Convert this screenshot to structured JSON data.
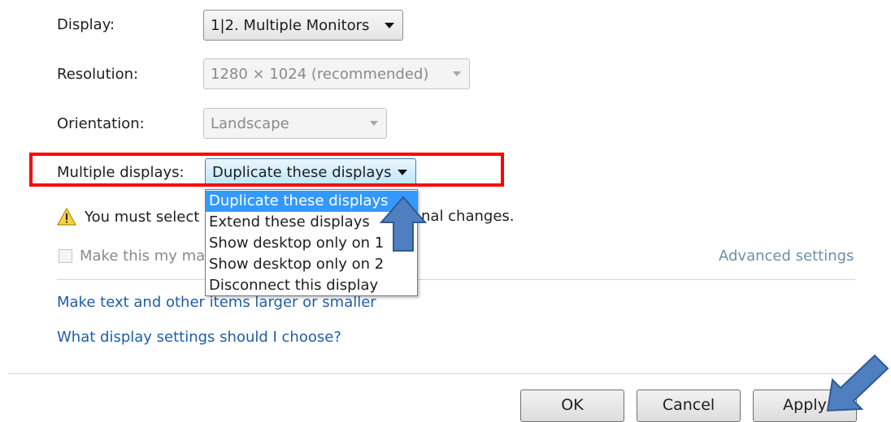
{
  "display": {
    "label": "Display:",
    "value": "1|2. Multiple Monitors"
  },
  "resolution": {
    "label": "Resolution:",
    "value": "1280 × 1024 (recommended)"
  },
  "orientation": {
    "label": "Orientation:",
    "value": "Landscape"
  },
  "multiple_displays": {
    "label": "Multiple displays:",
    "value": "Duplicate these displays",
    "options": [
      "Duplicate these displays",
      "Extend these displays",
      "Show desktop only on 1",
      "Show desktop only on 2",
      "Disconnect this display"
    ],
    "selected_index": 0
  },
  "warning": {
    "text_left": "You must select",
    "text_right": "nal changes."
  },
  "main_display_checkbox": {
    "label": "Make this my ma",
    "checked": false
  },
  "links": {
    "advanced": "Advanced settings",
    "text_size": "Make text and other items larger or smaller",
    "help": "What display settings should I choose?"
  },
  "buttons": {
    "ok": "OK",
    "cancel": "Cancel",
    "apply": "Apply"
  },
  "colors": {
    "highlight": "#ff0000",
    "link": "#1e5ea8",
    "selection": "#3399ff",
    "callout_arrow": "#4f7fbf"
  }
}
